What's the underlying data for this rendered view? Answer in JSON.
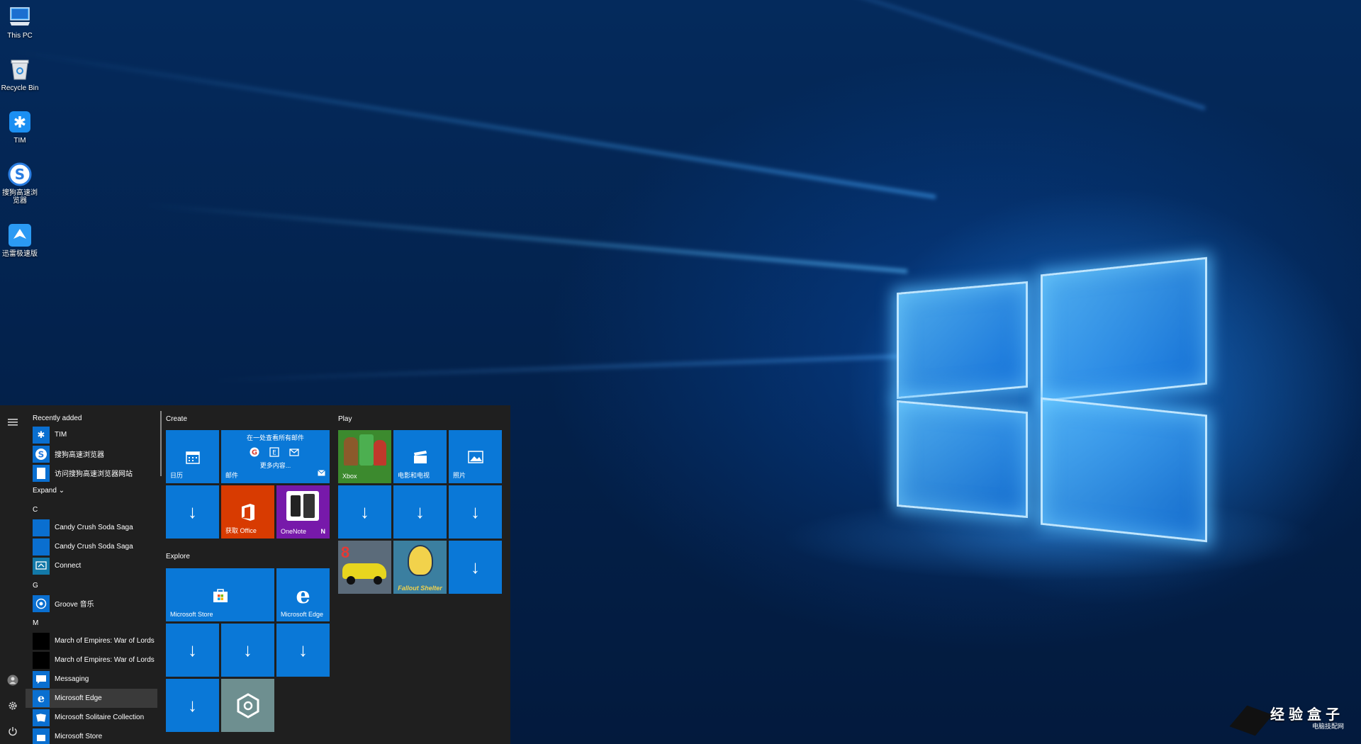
{
  "desktop": {
    "icons": [
      {
        "label": "This PC",
        "icon": "computer-icon"
      },
      {
        "label": "Recycle Bin",
        "icon": "recycle-bin-icon"
      },
      {
        "label": "TIM",
        "icon": "tim-icon"
      },
      {
        "label": "搜狗高速浏览器",
        "icon": "sogou-browser-icon"
      },
      {
        "label": "迅雷极速版",
        "icon": "xunlei-icon"
      }
    ]
  },
  "start_menu": {
    "recently_added_title": "Recently added",
    "recent": [
      {
        "label": "TIM",
        "icon": "tim-icon"
      },
      {
        "label": "搜狗高速浏览器",
        "icon": "sogou-browser-icon"
      },
      {
        "label": "访问搜狗高速浏览器网站",
        "icon": "document-icon"
      }
    ],
    "expand_label": "Expand",
    "sections": [
      {
        "letter": "C",
        "apps": [
          {
            "label": "Candy Crush Soda Saga"
          },
          {
            "label": "Candy Crush Soda Saga"
          },
          {
            "label": "Connect"
          }
        ]
      },
      {
        "letter": "G",
        "apps": [
          {
            "label": "Groove 音乐"
          }
        ]
      },
      {
        "letter": "M",
        "apps": [
          {
            "label": "March of Empires: War of Lords"
          },
          {
            "label": "March of Empires: War of Lords"
          },
          {
            "label": "Messaging"
          },
          {
            "label": "Microsoft Edge"
          },
          {
            "label": "Microsoft Solitaire Collection"
          },
          {
            "label": "Microsoft Store"
          }
        ]
      }
    ],
    "groups": {
      "create": "Create",
      "play": "Play",
      "explore": "Explore"
    },
    "tiles": {
      "calendar": "日历",
      "mail": "邮件",
      "mail_headline": "在一处查看所有邮件",
      "mail_more": "更多内容...",
      "office": "获取 Office",
      "onenote": "OneNote",
      "xbox": "Xbox",
      "movies": "电影和电视",
      "photos": "照片",
      "store": "Microsoft Store",
      "edge": "Microsoft Edge",
      "fallout": "Fallout Shelter",
      "asphalt": "8"
    }
  },
  "watermark": {
    "text": "经验盒子",
    "sub": "电脑技配网"
  },
  "colors": {
    "tile_blue": "#0a78d7",
    "start_bg": "#1f1f1f",
    "office_orange": "#d83b01",
    "onenote_purple": "#7719aa"
  }
}
